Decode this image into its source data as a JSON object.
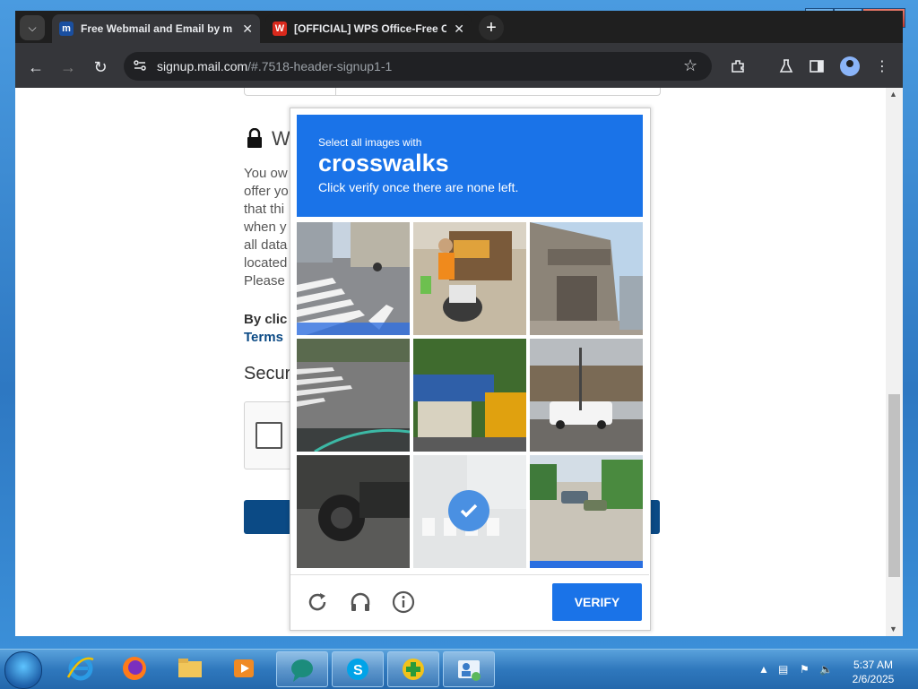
{
  "browser": {
    "tabs": [
      {
        "title": "Free Webmail and Email by m",
        "favicon": "mail-com-icon",
        "active": true
      },
      {
        "title": "[OFFICIAL] WPS Office-Free Of",
        "favicon": "wps-icon",
        "active": false
      }
    ],
    "url_host": "signup.mail.com",
    "url_path": "/#.7518-header-signup1-1"
  },
  "page": {
    "heading_fragment": "We",
    "paragraph_fragments": [
      "You ow",
      "offer yo",
      "that thi",
      "when y",
      "all data",
      "located",
      "Please"
    ],
    "agree_fragment": "By clic",
    "terms_fragment": "Terms",
    "security_fragment": "Secur"
  },
  "captcha": {
    "instruction_small": "Select all images with",
    "target": "crosswalks",
    "instruction_sub": "Click verify once there are none left.",
    "verify_label": "VERIFY",
    "tiles": [
      {
        "scene": "street-crosswalk-cyclist",
        "selected": false
      },
      {
        "scene": "market-motorbike",
        "selected": false
      },
      {
        "scene": "building-facade",
        "selected": false
      },
      {
        "scene": "road-crosswalk",
        "selected": false
      },
      {
        "scene": "trucks-trees",
        "selected": false
      },
      {
        "scene": "intersection-van",
        "selected": false
      },
      {
        "scene": "car-closeup",
        "selected": false
      },
      {
        "scene": "crosswalk-faded",
        "selected": true
      },
      {
        "scene": "street-parked-cars",
        "selected": false
      }
    ]
  },
  "taskbar": {
    "apps": [
      "internet-explorer-icon",
      "firefox-icon",
      "file-explorer-icon",
      "media-player-icon",
      "chat-app-icon",
      "skype-icon",
      "plus-app-icon",
      "contacts-app-icon"
    ],
    "time": "5:37 AM",
    "date": "2/6/2025"
  },
  "colors": {
    "captcha_blue": "#1a73e8",
    "page_button": "#0b4a85"
  }
}
